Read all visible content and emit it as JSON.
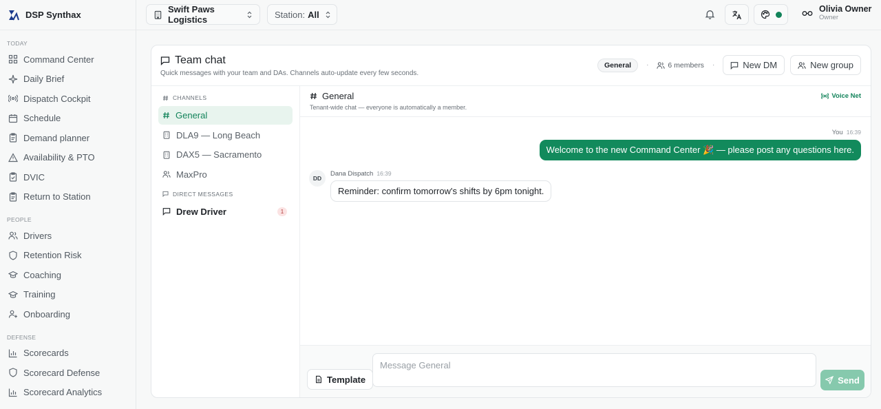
{
  "brand": {
    "name": "DSP Synthax"
  },
  "sidebar": {
    "sections": [
      {
        "label": "TODAY",
        "items": [
          {
            "label": "Command Center",
            "icon": "grid-icon"
          },
          {
            "label": "Daily Brief",
            "icon": "sparkle-icon"
          },
          {
            "label": "Dispatch Cockpit",
            "icon": "radio-icon"
          },
          {
            "label": "Schedule",
            "icon": "calendar-icon"
          },
          {
            "label": "Demand planner",
            "icon": "clipboard-icon"
          },
          {
            "label": "Availability & PTO",
            "icon": "warning-icon"
          },
          {
            "label": "DVIC",
            "icon": "clipboard-check-icon"
          },
          {
            "label": "Return to Station",
            "icon": "clipboard-icon"
          }
        ]
      },
      {
        "label": "PEOPLE",
        "items": [
          {
            "label": "Drivers",
            "icon": "users-icon"
          },
          {
            "label": "Retention Risk",
            "icon": "shield-icon"
          },
          {
            "label": "Coaching",
            "icon": "graduation-cap-icon"
          },
          {
            "label": "Training",
            "icon": "graduation-cap-icon"
          },
          {
            "label": "Onboarding",
            "icon": "user-plus-icon"
          }
        ]
      },
      {
        "label": "DEFENSE",
        "items": [
          {
            "label": "Scorecards",
            "icon": "bar-chart-icon"
          },
          {
            "label": "Scorecard Defense",
            "icon": "shield-icon"
          },
          {
            "label": "Scorecard Analytics",
            "icon": "bar-chart-icon"
          }
        ]
      }
    ]
  },
  "topbar": {
    "org": "Swift Paws Logistics",
    "station_label": "Station:",
    "station_value": "All",
    "user_name": "Olivia Owner",
    "user_role": "Owner",
    "status_color": "#12835a"
  },
  "team_chat": {
    "title": "Team chat",
    "subtitle": "Quick messages with your team and DAs. Channels auto-update every few seconds.",
    "current_channel_badge": "General",
    "separator": "·",
    "members": "6 members",
    "new_dm": "New DM",
    "new_group": "New group"
  },
  "channels": {
    "channels_label": "CHANNELS",
    "items": [
      {
        "label": "General"
      },
      {
        "label": "DLA9 — Long Beach"
      },
      {
        "label": "DAX5 — Sacramento"
      },
      {
        "label": "MaxPro"
      }
    ],
    "dm_label": "DIRECT MESSAGES",
    "dms": [
      {
        "label": "Drew Driver",
        "unread": "1"
      }
    ]
  },
  "chat": {
    "title": "General",
    "subtitle": "Tenant-wide chat — everyone is automatically a member.",
    "voice_net": "Voice Net",
    "messages": [
      {
        "author": "You",
        "time": "16:39",
        "text": "Welcome to the new Command Center 🎉 — please post any questions here."
      },
      {
        "author": "Dana Dispatch",
        "initials": "DD",
        "time": "16:39",
        "text": "Reminder: confirm tomorrow's shifts by 6pm tonight."
      }
    ],
    "composer": {
      "template_label": "Template",
      "placeholder": "Message General",
      "send_label": "Send"
    }
  },
  "colors": {
    "accent": "#12835a",
    "bubble": "#128a5c",
    "send_disabled": "#86c9ad"
  }
}
